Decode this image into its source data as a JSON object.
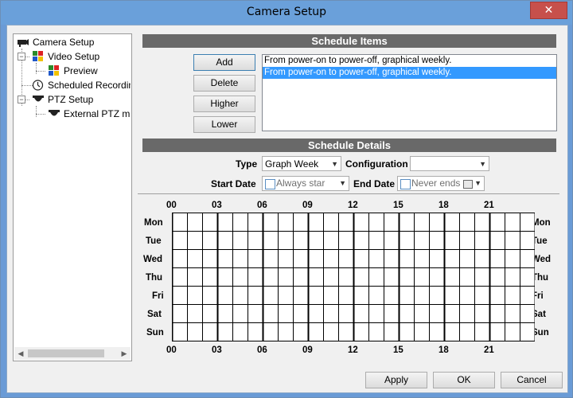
{
  "window": {
    "title": "Camera Setup",
    "close_glyph": "✕"
  },
  "tree": {
    "items": [
      {
        "label": "Camera Setup",
        "icon": "camera-icon"
      },
      {
        "label": "Video Setup",
        "icon": "color-grid-icon"
      },
      {
        "label": "Preview",
        "icon": "color-grid-icon"
      },
      {
        "label": "Scheduled Recording",
        "icon": "clock-icon"
      },
      {
        "label": "PTZ Setup",
        "icon": "dome-camera-icon"
      },
      {
        "label": "External PTZ module",
        "icon": "dome-camera-icon"
      }
    ],
    "expander_glyph": "−",
    "scroll_left": "◀",
    "scroll_right": "▶"
  },
  "schedule_items": {
    "header": "Schedule Items",
    "buttons": {
      "add": "Add",
      "delete": "Delete",
      "higher": "Higher",
      "lower": "Lower"
    },
    "list": [
      "From power-on to power-off, graphical weekly.",
      "From power-on to power-off, graphical weekly."
    ],
    "selected_index": 1
  },
  "schedule_details": {
    "header": "Schedule Details",
    "type_label": "Type",
    "type_value": "Graph Week",
    "configuration_label": "Configuration",
    "configuration_value": "",
    "start_date_label": "Start Date",
    "start_date_value": "Always star",
    "end_date_label": "End Date",
    "end_date_value": "Never ends",
    "dropdown_glyph": "▼"
  },
  "grid": {
    "days": [
      "Mon",
      "Tue",
      "Wed",
      "Thu",
      "Fri",
      "Sat",
      "Sun"
    ],
    "hour_labels": [
      "00",
      "03",
      "06",
      "09",
      "12",
      "15",
      "18",
      "21"
    ],
    "hours_per_day": 24
  },
  "footer": {
    "apply": "Apply",
    "ok": "OK",
    "cancel": "Cancel"
  },
  "colors": {
    "section_header_bg": "#696969",
    "selection": "#3399ff",
    "title_bar": "#6aa0da",
    "close_button": "#c7504b"
  }
}
